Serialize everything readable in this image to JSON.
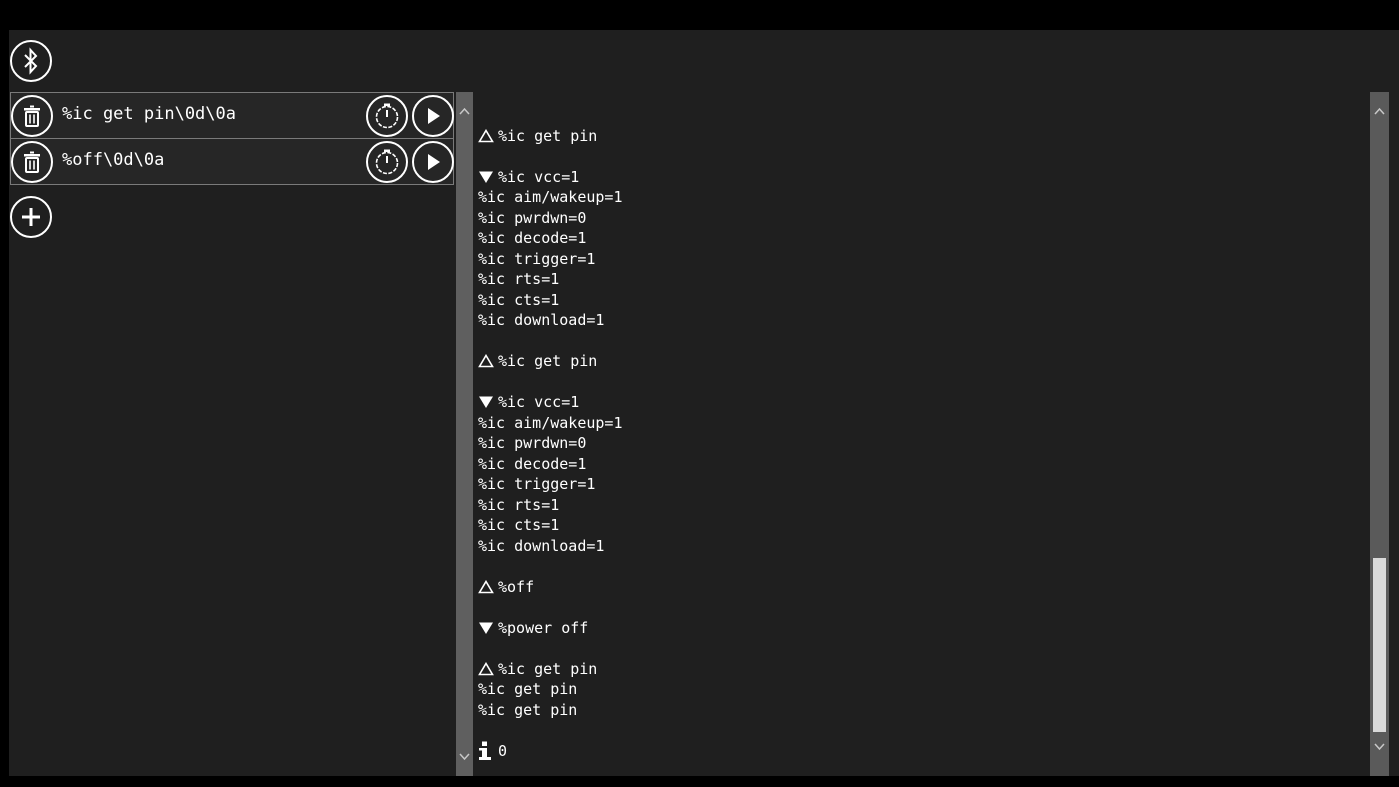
{
  "toolbar": {
    "bluetooth_icon": "bluetooth-icon",
    "add_icon": "plus-icon"
  },
  "commands": [
    {
      "text": "%ic get pin\\0d\\0a"
    },
    {
      "text": "%off\\0d\\0a"
    }
  ],
  "log": [
    {
      "type": "blank",
      "text": ""
    },
    {
      "type": "sent",
      "text": "%ic get pin"
    },
    {
      "type": "blank",
      "text": ""
    },
    {
      "type": "recv",
      "text": "%ic vcc=1"
    },
    {
      "type": "plain",
      "text": "%ic aim/wakeup=1"
    },
    {
      "type": "plain",
      "text": "%ic pwrdwn=0"
    },
    {
      "type": "plain",
      "text": "%ic decode=1"
    },
    {
      "type": "plain",
      "text": "%ic trigger=1"
    },
    {
      "type": "plain",
      "text": "%ic rts=1"
    },
    {
      "type": "plain",
      "text": "%ic cts=1"
    },
    {
      "type": "plain",
      "text": "%ic download=1"
    },
    {
      "type": "blank",
      "text": ""
    },
    {
      "type": "sent",
      "text": "%ic get pin"
    },
    {
      "type": "blank",
      "text": ""
    },
    {
      "type": "recv",
      "text": "%ic vcc=1"
    },
    {
      "type": "plain",
      "text": "%ic aim/wakeup=1"
    },
    {
      "type": "plain",
      "text": "%ic pwrdwn=0"
    },
    {
      "type": "plain",
      "text": "%ic decode=1"
    },
    {
      "type": "plain",
      "text": "%ic trigger=1"
    },
    {
      "type": "plain",
      "text": "%ic rts=1"
    },
    {
      "type": "plain",
      "text": "%ic cts=1"
    },
    {
      "type": "plain",
      "text": "%ic download=1"
    },
    {
      "type": "blank",
      "text": ""
    },
    {
      "type": "sent",
      "text": "%off"
    },
    {
      "type": "blank",
      "text": ""
    },
    {
      "type": "recv",
      "text": "%power off"
    },
    {
      "type": "blank",
      "text": ""
    },
    {
      "type": "sent",
      "text": "%ic get pin"
    },
    {
      "type": "plain",
      "text": "%ic get pin"
    },
    {
      "type": "plain",
      "text": "%ic get pin"
    },
    {
      "type": "blank",
      "text": ""
    },
    {
      "type": "info",
      "text": "0"
    }
  ],
  "colors": {
    "background": "#1f1f1f",
    "scrollbar": "#5f5f5f",
    "thumb": "#d9d9d9"
  }
}
